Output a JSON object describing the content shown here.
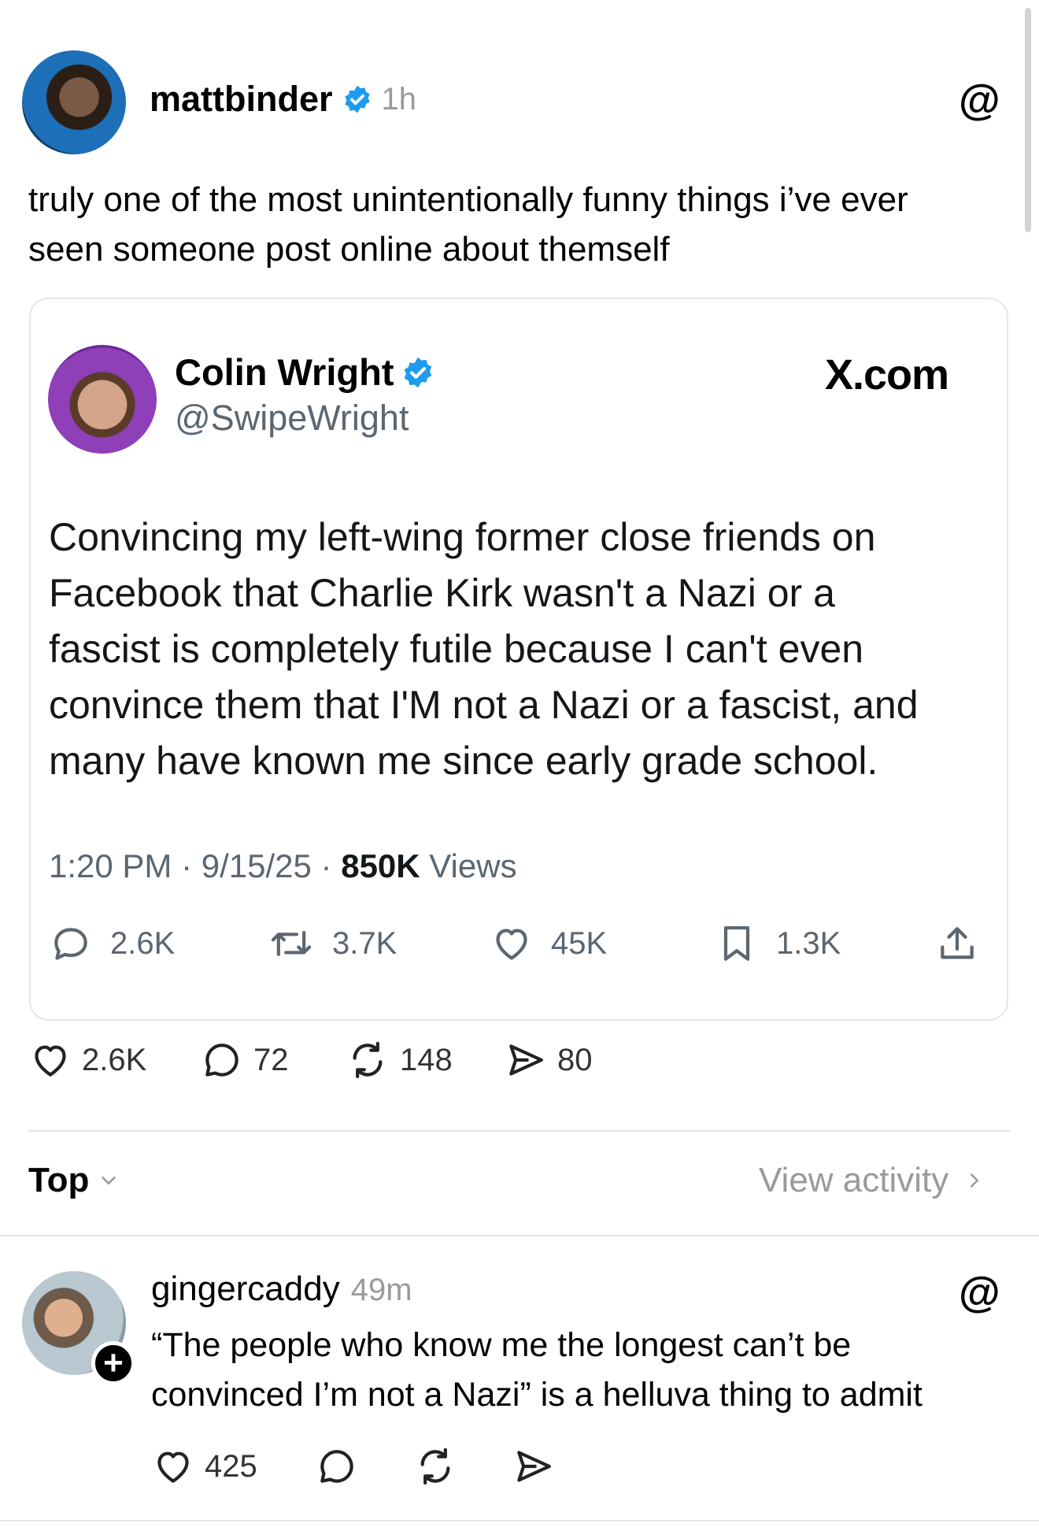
{
  "post": {
    "username": "mattbinder",
    "time": "1h",
    "text_lines": [
      "truly one of the most unintentionally funny things i’ve ever",
      "seen someone post online about themself"
    ],
    "stats": {
      "likes": "2.6K",
      "comments": "72",
      "reposts": "148",
      "shares": "80"
    }
  },
  "embed": {
    "name": "Colin Wright",
    "handle": "@SwipeWright",
    "source": "X.com",
    "text_lines": [
      "Convincing my left-wing former close friends on",
      "Facebook that Charlie Kirk wasn't a Nazi or a",
      "fascist is completely futile because I can't even",
      "convince them that I'M not a Nazi or a fascist, and",
      "many have known me since early grade school."
    ],
    "time": "1:20 PM",
    "date": "9/15/25",
    "views_count": "850K",
    "views_label": "Views",
    "replies": "2.6K",
    "retweets": "3.7K",
    "likes": "45K",
    "bookmarks": "1.3K"
  },
  "sort": {
    "label": "Top",
    "view_activity": "View activity"
  },
  "reply": {
    "username": "gingercaddy",
    "time": "49m",
    "text_lines": [
      "“The people who know me the longest can’t be",
      "convinced I’m not a Nazi” is a helluva thing to admit"
    ],
    "likes": "425"
  },
  "colors": {
    "verified": "#1d9bf0",
    "muted": "#9a9a9a",
    "divider": "#e6e6e6"
  },
  "icons": [
    "verified-badge",
    "threads-logo",
    "heart",
    "comment",
    "repost",
    "share",
    "retweet",
    "bookmark",
    "upload",
    "chevron-down",
    "chevron-right",
    "plus"
  ]
}
